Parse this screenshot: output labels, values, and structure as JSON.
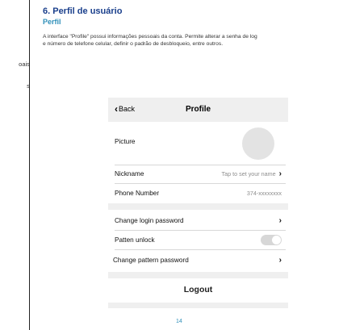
{
  "left_fragment": [
    "oais.",
    "s."
  ],
  "section": {
    "title": "6. Perfil de usuário",
    "subtitle": "Perfil",
    "desc_line1": "A interface \"Profile\" possui informações pessoais da conta. Permite alterar a senha de log",
    "desc_line2": "e número de telefone celular, definir o padrão de desbloqueio, entre outros."
  },
  "nav": {
    "back_label": "Back",
    "title": "Profile"
  },
  "rows": {
    "picture": "Picture",
    "nickname": "Nickname",
    "nickname_value": "Tap to set your name",
    "phone": "Phone Number",
    "phone_value": "374-xxxxxxxx",
    "change_login": "Change login password",
    "pattern_unlock": "Patten unlock",
    "change_pattern": "Change pattern password"
  },
  "pattern_unlock_enabled": false,
  "logout_label": "Logout",
  "page_number": "14"
}
